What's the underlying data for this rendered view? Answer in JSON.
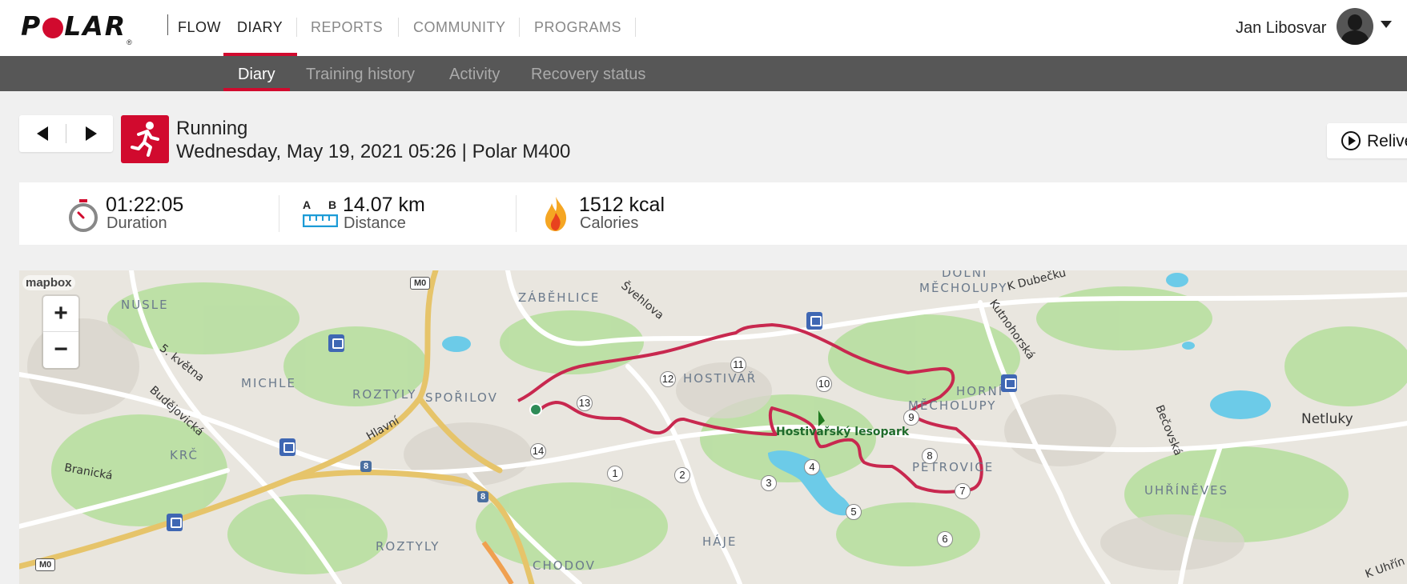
{
  "brand": {
    "logo_text": "POLAR",
    "product": "FLOW"
  },
  "nav": {
    "tabs": [
      {
        "label": "DIARY",
        "active": true
      },
      {
        "label": "REPORTS"
      },
      {
        "label": "COMMUNITY"
      },
      {
        "label": "PROGRAMS"
      }
    ]
  },
  "user": {
    "name": "Jan Libosvar"
  },
  "subnav": {
    "tabs": [
      {
        "label": "Diary",
        "active": true
      },
      {
        "label": "Training history"
      },
      {
        "label": "Activity"
      },
      {
        "label": "Recovery status"
      }
    ]
  },
  "session": {
    "sport": "Running",
    "datetime": "Wednesday, May 19, 2021 05:26 | Polar M400",
    "relive_label": "Relive"
  },
  "summary": {
    "duration": {
      "value": "01:22:05",
      "label": "Duration",
      "icon": "stopwatch-icon"
    },
    "distance": {
      "value": "14.07 km",
      "label": "Distance",
      "icon": "ruler-icon",
      "a_label": "A",
      "b_label": "B"
    },
    "calories": {
      "value": "1512 kcal",
      "label": "Calories",
      "icon": "flame-icon"
    }
  },
  "map": {
    "attribution": "mapbox",
    "zoom_in": "+",
    "zoom_out": "−",
    "labels": {
      "nusle": "NUSLE",
      "michle": "MICHLE",
      "krc": "KRČ",
      "roztyly1": "ROZTYLY",
      "roztyly2": "ROZTYLY",
      "sporilov": "SPOŘILOV",
      "zabehlice": "ZÁBĚHLICE",
      "hostivar": "HOSTIVAŘ",
      "haje": "HÁJE",
      "chodov": "CHODOV",
      "dolni_mecholupy_1": "DOLNÍ",
      "dolni_mecholupy_2": "MĚCHOLUPY",
      "horni": "HORNÍ",
      "mecholupy": "MĚCHOLUPY",
      "petrovice": "PETROVICE",
      "uhrineves": "UHŘÍNĚVES",
      "netluky": "Netluky",
      "park": "Hostivařský lesopark",
      "road_kvetna": "5. května",
      "road_budejovicka": "Budějovická",
      "road_branicka": "Branická",
      "road_hlavni": "Hlavní",
      "road_svehlova": "Švehlova",
      "road_kutnohorska": "Kutnohorská",
      "road_kdubecku": "K Dubečku",
      "road_becovska": "Bečovská",
      "road_kuhrin": "K Uhřín",
      "m0_1": "M0",
      "m0_2": "M0",
      "r8_1": "8",
      "r8_2": "8"
    },
    "route_color": "#c8284f",
    "km_markers": [
      "1",
      "2",
      "3",
      "4",
      "5",
      "6",
      "7",
      "8",
      "9",
      "10",
      "11",
      "12",
      "13",
      "14"
    ]
  }
}
